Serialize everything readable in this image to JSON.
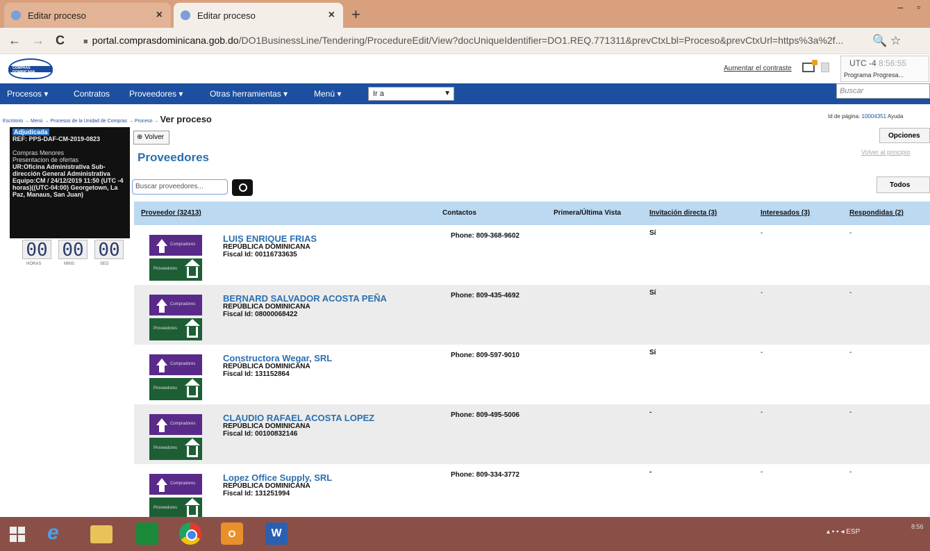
{
  "browser": {
    "tabs": [
      {
        "label": "Editar proceso",
        "close": "×"
      },
      {
        "label": "Editar proceso",
        "close": "×"
      }
    ],
    "new_tab": "+",
    "window_controls": "– ▫",
    "url_domain": "portal.comprasdominicana.gob.do",
    "url_path": "/DO1BusinessLine/Tendering/ProcedureEdit/View?docUniqueIdentifier=DO1.REQ.771311&prevCtxLbl=Proceso&prevCtxUrl=https%3a%2f...",
    "back": "←",
    "forward": "→",
    "reload": "C",
    "zoom_icon": "🔍",
    "star_icon": "☆"
  },
  "header": {
    "logo_text": "COMPRAS DOMINICANA",
    "contrast_link": "Aumentar el contraste",
    "utc": "UTC -4",
    "clock": "8:56:55",
    "program": "Programa Progresa..."
  },
  "nav": {
    "items": [
      "Procesos ▾",
      "Contratos",
      "Proveedores ▾",
      "Otras herramientas ▾",
      "Menú ▾"
    ],
    "goto_label": "Ir a",
    "search_placeholder": "Buscar"
  },
  "breadcrumb": {
    "path": "Escritorio → Menú → Procesos de la Unidad de Compras → Proceso →",
    "current": "Ver proceso"
  },
  "page_id": {
    "label": "Id de página:",
    "value": "10004351",
    "help": "Ayuda"
  },
  "info_panel": {
    "status": "Adjudicada",
    "ref": "REF: PPS-DAF-CM-2019-0823",
    "modality": "Compras Menores",
    "phase": "Presentacion de ofertas",
    "unit": "UR:Oficina Administrativa Sub-dirección General Administrativa",
    "team": "Equipo:CM / 24/12/2019 11:50 (UTC -4 horas)((UTC-04:00) Georgetown, La Paz, Manaus, San Juan)"
  },
  "timer": {
    "hours": "00",
    "mins": "00",
    "secs": "00",
    "h_label": "HORAS",
    "m_label": "MINS",
    "s_label": "SEG"
  },
  "actions": {
    "back": "Volver",
    "options": "Opciones",
    "back_top": "Volver al principio",
    "all": "Todos"
  },
  "section_title": "Proveedores",
  "search": {
    "placeholder": "Buscar proveedores..."
  },
  "table": {
    "headers": [
      "Proveedor (32413)",
      "Contactos",
      "Primera/Última Vista",
      "Invitación directa (3)",
      "Interesados (3)",
      "Respondidas (2)"
    ],
    "logo_top": "Compradores",
    "logo_bottom": "Proveedores",
    "rows": [
      {
        "name": "LUIS ENRIQUE FRIAS",
        "country": "REPÚBLICA DOMINICANA",
        "fiscal": "Fiscal Id: 00116733635",
        "phone": "Phone: 809-368-9602",
        "invitation": "Sí",
        "interested": "-",
        "responded": "-"
      },
      {
        "name": "BERNARD SALVADOR ACOSTA PEÑA",
        "country": "REPÚBLICA DOMINICANA",
        "fiscal": "Fiscal Id: 08000068422",
        "phone": "Phone: 809-435-4692",
        "invitation": "Sí",
        "interested": "-",
        "responded": "-"
      },
      {
        "name": "Constructora Wegar, SRL",
        "country": "REPÚBLICA DOMINICANA",
        "fiscal": "Fiscal Id: 131152864",
        "phone": "Phone: 809-597-9010",
        "invitation": "Sí",
        "interested": "-",
        "responded": "-"
      },
      {
        "name": "CLAUDIO RAFAEL ACOSTA LOPEZ",
        "country": "REPÚBLICA DOMINICANA",
        "fiscal": "Fiscal Id: 00100832146",
        "phone": "Phone: 809-495-5006",
        "invitation": "-",
        "interested": "-",
        "responded": "-"
      },
      {
        "name": "Lopez Office Supply, SRL",
        "country": "REPÚBLICA DOMINICANA",
        "fiscal": "Fiscal Id: 131251994",
        "phone": "Phone: 809-334-3772",
        "invitation": "-",
        "interested": "-",
        "responded": "-"
      }
    ]
  },
  "taskbar": {
    "tray_lang": "ESP",
    "tray_time": "8:56"
  }
}
